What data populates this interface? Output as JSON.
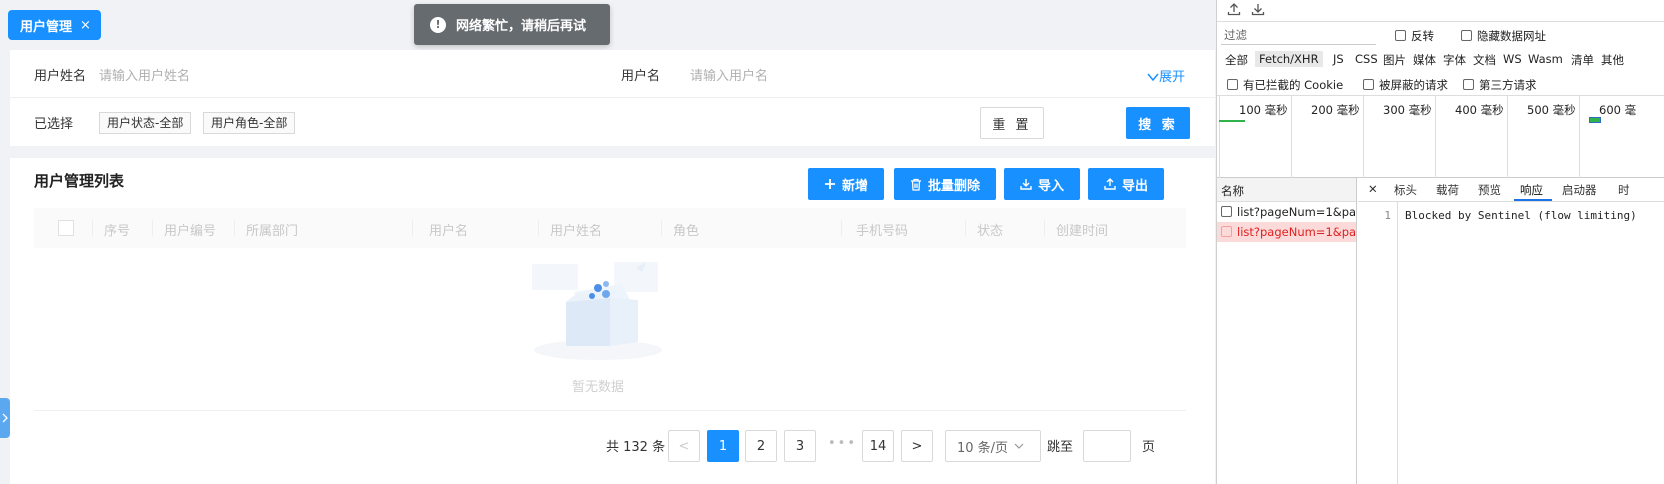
{
  "tagbar": {
    "active_tag": "用户管理",
    "close_glyph": "×"
  },
  "toast": {
    "message": "网络繁忙，请稍后再试"
  },
  "search": {
    "user_fullname_label": "用户姓名",
    "user_fullname_placeholder": "请输入用户姓名",
    "username_label": "用户名",
    "username_placeholder": "请输入用户名",
    "expand_label": "展开",
    "selected_label": "已选择",
    "chips": [
      "用户状态-全部",
      "用户角色-全部"
    ],
    "reset_label": "重 置",
    "search_label": "搜 索"
  },
  "list": {
    "title": "用户管理列表",
    "buttons": {
      "add": "新增",
      "batch_delete": "批量删除",
      "import": "导入",
      "export": "导出"
    },
    "columns": [
      "序号",
      "用户编号",
      "所属部门",
      "用户名",
      "用户姓名",
      "角色",
      "手机号码",
      "状态",
      "创建时间"
    ],
    "empty_text": "暂无数据"
  },
  "pagination": {
    "total_text": "共 132 条",
    "prev": "<",
    "next": ">",
    "pages": [
      "1",
      "2",
      "3",
      "14"
    ],
    "ellipsis": "•••",
    "current_page": "1",
    "page_size": "10 条/页",
    "jump_label": "跳至",
    "page_suffix": "页"
  },
  "devtools": {
    "filter_placeholder": "过滤",
    "invert_label": "反转",
    "hide_data_urls_label": "隐藏数据网址",
    "types": [
      "全部",
      "Fetch/XHR",
      "JS",
      "CSS",
      "图片",
      "媒体",
      "字体",
      "文档",
      "WS",
      "Wasm",
      "清单",
      "其他"
    ],
    "selected_type": "Fetch/XHR",
    "blocked_cookies_label": "有已拦截的 Cookie",
    "blocked_requests_label": "被屏蔽的请求",
    "third_party_label": "第三方请求",
    "timeline_labels": [
      "100 毫秒",
      "200 毫秒",
      "300 毫秒",
      "400 毫秒",
      "500 毫秒",
      "600 毫"
    ],
    "name_header": "名称",
    "requests": [
      {
        "name": "list?pageNum=1&pa...",
        "status": "ok"
      },
      {
        "name": "list?pageNum=1&pa...",
        "status": "error"
      }
    ],
    "detail_tabs": [
      "标头",
      "载荷",
      "预览",
      "响应",
      "启动器",
      "时"
    ],
    "active_tab": "响应",
    "response_line_number": "1",
    "response_body": "Blocked by Sentinel (flow limiting)",
    "accent_color": "#1a73e8",
    "error_color": "#e02020"
  },
  "colors": {
    "primary": "#1890ff",
    "toast_bg": "#666b6f"
  }
}
